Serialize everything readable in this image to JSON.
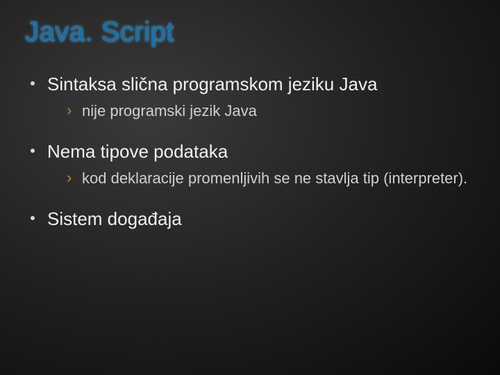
{
  "slide": {
    "title": "Java. Script",
    "bullets": [
      {
        "text": "Sintaksa slična programskom jeziku Java",
        "sub": [
          "nije programski jezik Java"
        ]
      },
      {
        "text": "Nema tipove podataka",
        "sub": [
          "kod deklaracije promenljivih se ne stavlja tip (interpreter)."
        ]
      },
      {
        "text": "Sistem događaja",
        "sub": []
      }
    ]
  }
}
